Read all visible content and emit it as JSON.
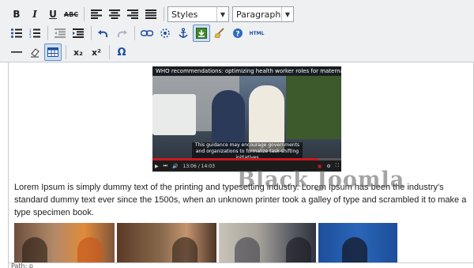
{
  "toolbar": {
    "row1": {
      "bold": "B",
      "italic": "I",
      "underline": "U",
      "strike": "ABC",
      "styles_select": "Styles",
      "format_select": "Paragraph"
    },
    "row2": {
      "html_label": "HTML"
    },
    "row3": {
      "subscript": "x₂",
      "superscript": "x²",
      "omega": "Ω"
    }
  },
  "video": {
    "title": "WHO recommendations: optimizing health worker roles for materna",
    "caption": "This guidance may encourage governments and organizations to formalize task-shifting initiatives",
    "time": "13:06 / 14:03"
  },
  "content": {
    "paragraph_lines": [
      "Lorem Ipsum is simply dummy text of the printing and typesetting industry. Lorem Ipsum has been the industry's",
      "standard dummy text ever since the 1500s, when an unknown printer took a galley of type and scrambled it to make a",
      "type specimen book."
    ]
  },
  "watermark": "Black Joomla",
  "status": "Path: p"
}
